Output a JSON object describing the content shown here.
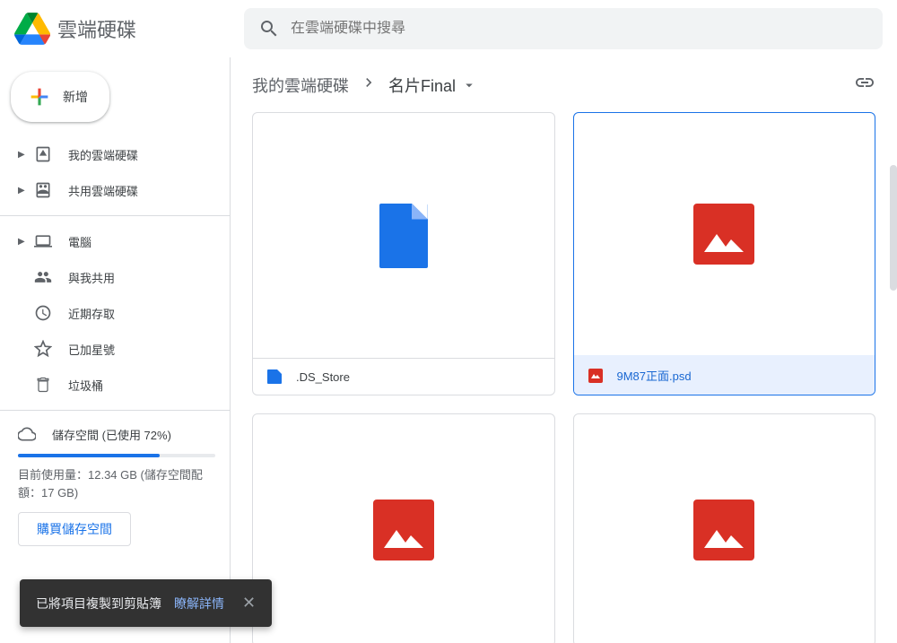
{
  "app": {
    "title": "雲端硬碟"
  },
  "search": {
    "placeholder": "在雲端硬碟中搜尋"
  },
  "sidebar": {
    "new_label": "新增",
    "items": [
      {
        "label": "我的雲端硬碟",
        "has_chevron": true,
        "icon": "drive"
      },
      {
        "label": "共用雲端硬碟",
        "has_chevron": true,
        "icon": "shared-drive"
      }
    ],
    "items2": [
      {
        "label": "電腦",
        "has_chevron": true,
        "icon": "computer"
      },
      {
        "label": "與我共用",
        "has_chevron": false,
        "icon": "people"
      },
      {
        "label": "近期存取",
        "has_chevron": false,
        "icon": "clock"
      },
      {
        "label": "已加星號",
        "has_chevron": false,
        "icon": "star"
      },
      {
        "label": "垃圾桶",
        "has_chevron": false,
        "icon": "trash"
      }
    ],
    "storage": {
      "label": "儲存空間 (已使用 72%)",
      "percent": 72,
      "usage_text": "目前使用量：12.34 GB (儲存空間配額：17 GB)",
      "buy_label": "購買儲存空間"
    }
  },
  "breadcrumb": {
    "parent": "我的雲端硬碟",
    "current": "名片Final"
  },
  "files": [
    {
      "name": ".DS_Store",
      "type": "file",
      "selected": false
    },
    {
      "name": "9M87正面.psd",
      "type": "image",
      "selected": true
    },
    {
      "name": "",
      "type": "image",
      "selected": false
    },
    {
      "name": "",
      "type": "image",
      "selected": false
    }
  ],
  "toast": {
    "message": "已將項目複製到剪貼簿",
    "link": "瞭解詳情"
  }
}
